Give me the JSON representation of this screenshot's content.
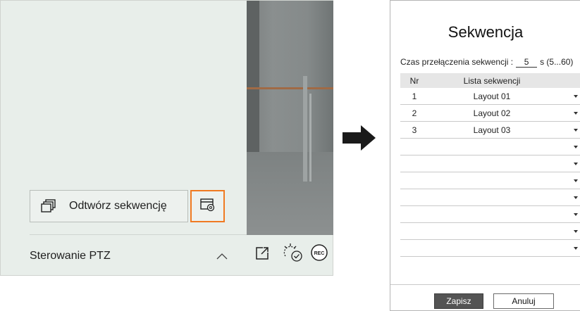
{
  "left_panel": {
    "play_sequence_label": "Odtwórz sekwencję",
    "ptz_label": "Sterowanie PTZ",
    "rec_label": "REC"
  },
  "dialog": {
    "title": "Sekwencja",
    "switch_time_label": "Czas przełączenia sekwencji :",
    "switch_time_value": "5",
    "switch_time_range": "s (5...60)",
    "columns": [
      "Nr",
      "Lista sekwencji"
    ],
    "rows": [
      {
        "nr": "1",
        "layout": "Layout 01"
      },
      {
        "nr": "2",
        "layout": "Layout 02"
      },
      {
        "nr": "3",
        "layout": "Layout 03"
      },
      {
        "nr": "",
        "layout": ""
      },
      {
        "nr": "",
        "layout": ""
      },
      {
        "nr": "",
        "layout": ""
      },
      {
        "nr": "",
        "layout": ""
      },
      {
        "nr": "",
        "layout": ""
      },
      {
        "nr": "",
        "layout": ""
      },
      {
        "nr": "",
        "layout": ""
      }
    ],
    "save_label": "Zapisz",
    "cancel_label": "Anuluj"
  },
  "colors": {
    "highlight": "#f07a22",
    "save_button": "#545454"
  },
  "icons": [
    "windows-stack-icon",
    "sequence-settings-icon",
    "chevron-up-icon",
    "popout-icon",
    "day-night-icon",
    "rec-icon",
    "arrow-right-icon"
  ]
}
